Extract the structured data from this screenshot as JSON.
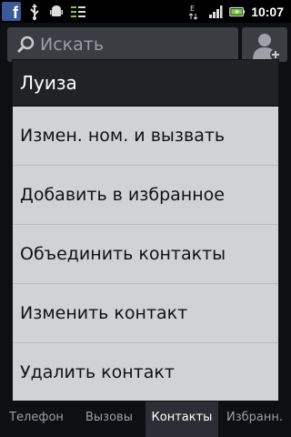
{
  "status_bar": {
    "time": "10:07",
    "icons": [
      "facebook-icon",
      "usb-icon",
      "android-debug-icon",
      "sync-icon",
      "e-network-icon",
      "signal-icon",
      "battery-icon"
    ]
  },
  "search": {
    "placeholder": "Искать"
  },
  "dialog": {
    "title": "Луиза",
    "items": [
      {
        "label": "Измен. ном. и вызвать"
      },
      {
        "label": "Добавить в избранное"
      },
      {
        "label": "Объединить контакты"
      },
      {
        "label": "Изменить контакт"
      },
      {
        "label": "Удалить контакт"
      }
    ]
  },
  "tabs": [
    {
      "label": "Телефон"
    },
    {
      "label": "Вызовы"
    },
    {
      "label": "Контакты"
    },
    {
      "label": "Избранн."
    }
  ],
  "colors": {
    "dialog_bg": "#cfd3d6",
    "dialog_title_bg": "#1f2326",
    "facebook_blue": "#3b5998",
    "battery_green": "#6fcf3a"
  }
}
